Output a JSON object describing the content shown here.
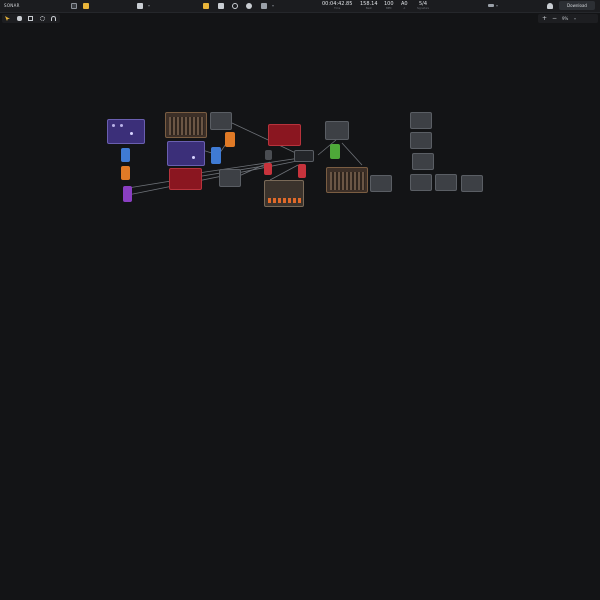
{
  "app": {
    "brand": "SONAR"
  },
  "transport": {
    "time": {
      "value": "00:04:42.85",
      "label": "Time"
    },
    "beat": {
      "value": "158.14",
      "label": "Beat"
    },
    "bpm": {
      "value": "100",
      "label": "BPM"
    },
    "root": {
      "value": "A0",
      "label": "A"
    },
    "signature": {
      "value": "5/4",
      "label": "Signature"
    }
  },
  "actions": {
    "download_label": "Download"
  },
  "zoom": {
    "level": "9%"
  },
  "colors": {
    "background": "#131416",
    "bar": "#1b1c1f",
    "accent_yellow": "#e8b43a",
    "cable": "#6e7278"
  },
  "icons": [
    "layout-icon",
    "folder-icon",
    "save-icon",
    "record-icon",
    "loop-icon",
    "play-icon",
    "metronome-icon",
    "users-icon",
    "pointer-icon",
    "hand-icon",
    "select-icon",
    "move-icon",
    "headphones-icon",
    "plus-icon",
    "minus-icon"
  ],
  "modules": [
    "synth-purple-1",
    "sequencer-1",
    "empty-1",
    "synth-purple-2",
    "filter-red-1",
    "empty-2",
    "sequencer-red-2",
    "mixer",
    "drum-machine",
    "empty-3",
    "sequencer-3",
    "empty-4",
    "grid-group"
  ]
}
